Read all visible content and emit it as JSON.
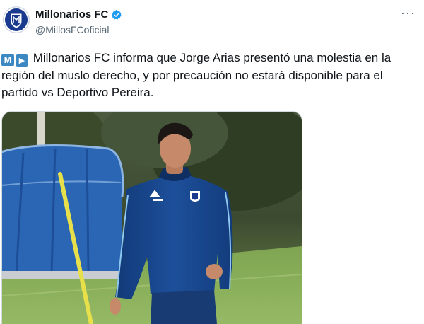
{
  "account": {
    "name": "Millonarios FC",
    "handle": "@MillosFCoficial",
    "avatar_icon": "millonarios-crest-icon",
    "verified_icon": "verified-badge-icon"
  },
  "menu": {
    "more_label": "···"
  },
  "tweet": {
    "emoji_1": "M",
    "emoji_2": "▶",
    "text": "Millonarios FC informa que Jorge Arias presentó una molestia en la región del muslo derecho, y por precaución no estará disponible para el partido vs Deportivo Pereira."
  },
  "media": {
    "kind": "photo",
    "description_icon": "player-photo"
  },
  "colors": {
    "brand_blue": "#1a3a8f",
    "verified": "#1d9bf0",
    "text": "#0f1419",
    "muted": "#536471"
  }
}
